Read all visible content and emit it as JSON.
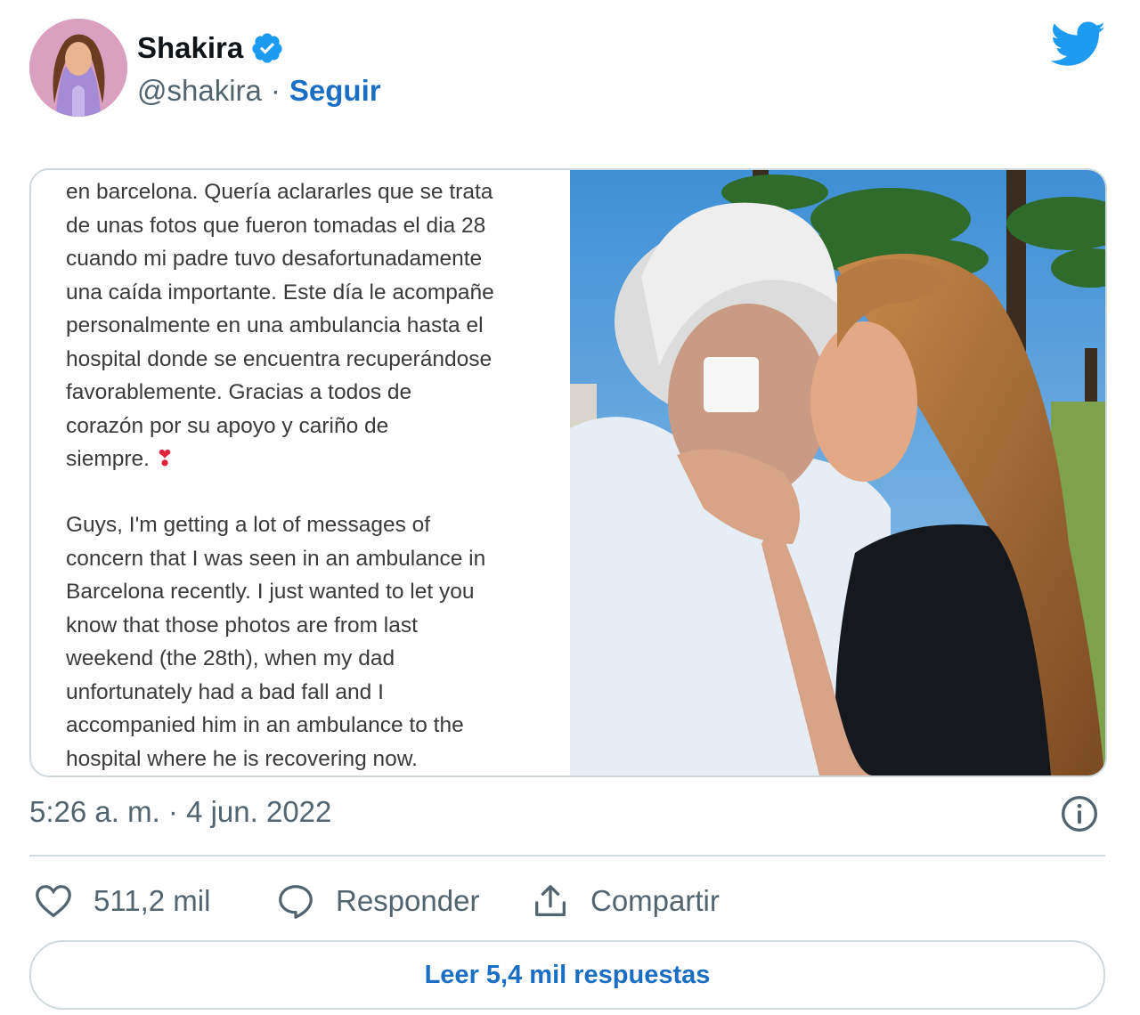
{
  "user": {
    "name": "Shakira",
    "handle": "@shakira",
    "separator": "·",
    "follow_label": "Seguir"
  },
  "media": {
    "spanish_text": "en barcelona. Quería aclararles que se trata\nde unas fotos que fueron tomadas el dia 28\ncuando mi padre tuvo desafortunadamente\nuna caída importante. Este día le acompañe\npersonalmente en una ambulancia hasta el\nhospital donde se encuentra recuperándose\nfavorablemente. Gracias a todos de\ncorazón por su apoyo y cariño de\nsiempre.",
    "spanish_emoji": "❣",
    "english_text": "Guys, I'm getting a lot of messages of\nconcern that I was seen in an ambulance in\nBarcelona recently. I just wanted to let you\nknow that those photos are from last\nweekend (the 28th), when my dad\nunfortunately had a bad fall and I\naccompanied him in an ambulance to the\nhospital where he is recovering now."
  },
  "timestamp": "5:26 a. m. · 4 jun. 2022",
  "actions": {
    "like_count": "511,2 mil",
    "reply_label": "Responder",
    "share_label": "Compartir"
  },
  "read_replies_label": "Leer 5,4 mil respuestas",
  "colors": {
    "accent": "#1a6fc4",
    "twitter_blue": "#1d9bf0",
    "secondary_text": "#536471",
    "border": "#cfd9de"
  },
  "icons": [
    "verified-badge-icon",
    "twitter-bird-icon",
    "info-icon",
    "heart-icon",
    "reply-icon",
    "share-icon"
  ]
}
